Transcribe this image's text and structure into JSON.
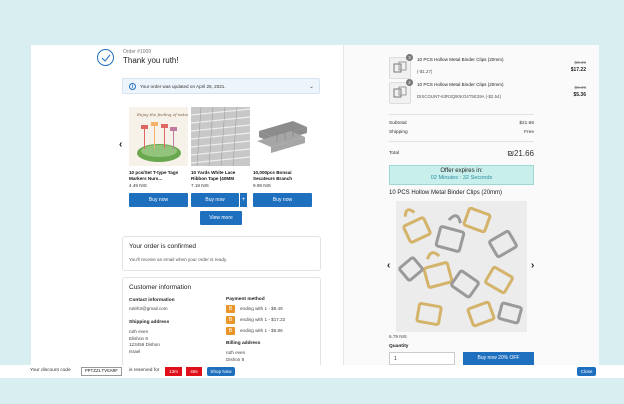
{
  "header": {
    "order_number": "Order #1009",
    "thank_you": "Thank you ruth!"
  },
  "update_notice": {
    "text": "Your order was updated on April 25, 2021.",
    "info_glyph": "i",
    "chevron": "⌄"
  },
  "recommendations": {
    "products": [
      {
        "name": "10 pcs/Set T-type Tags Markers Nurs...",
        "price": "4.49 NIS",
        "buy_label": "Buy now"
      },
      {
        "name": "10 Yards White Lace Ribbon Tape (40MM",
        "price": "7.18 NIS",
        "buy_label": "Buy now",
        "plus_label": "+"
      },
      {
        "name": "10,000pcs Bonsai Secateurs Branch",
        "price": "9.99 NIS",
        "buy_label": "Buy now"
      }
    ],
    "view_more": "View more",
    "prev_arrow": "‹",
    "next_arrow": "›"
  },
  "confirmed": {
    "title": "Your order is confirmed",
    "text": "You'll receive an email when your order is ready."
  },
  "customer_info": {
    "title": "Customer information",
    "contact_label": "Contact information",
    "email": "ruteh2@gmail.com",
    "shipping_label": "Shipping address",
    "shipping_lines": [
      "ruth even",
      "Elishon 8",
      "123456 Dishon",
      "Israel"
    ],
    "payment_label": "Payment method",
    "payments": [
      {
        "icon": "B",
        "text": "ending with 1 - $8.49"
      },
      {
        "icon": "B",
        "text": "ending with 1 - $17.22"
      },
      {
        "icon": "B",
        "text": "ending with 1 - $5.86"
      }
    ],
    "billing_label": "Billing address",
    "billing_lines": [
      "ruth even",
      "Dishon 8"
    ]
  },
  "cart": {
    "items": [
      {
        "qty": "3",
        "name": "10 PCS Hollow Metal Binder Clips (20mm)",
        "discount": "(-$1.27)",
        "original": "$8.49",
        "price": "$17.22"
      },
      {
        "qty": "2",
        "name": "10 PCS Hollow Metal Binder Clips (20mm)",
        "discount": "DISCOUNT-63R3Q90KO4T5E29A (-$2.54)",
        "original": "$8.49",
        "price": "$5.36"
      }
    ],
    "subtotal_label": "Subtotal",
    "subtotal_value": "$21.66",
    "shipping_label": "Shipping",
    "shipping_value": "Free",
    "total_label": "Total",
    "total_value": "₪21.66"
  },
  "offer": {
    "title": "Offer expires in:",
    "countdown": "02 Minutes : 32 Seconds",
    "product_title": "10 PCS Hollow Metal Binder Clips (20mm)",
    "price": "6.79 NIS",
    "quantity_label": "Quantity",
    "quantity_value": "1",
    "buy_label": "Buy now 20% OFF"
  },
  "bottom_bar": {
    "code_label": "Your discount code",
    "code": "PPTZZLTVGARF",
    "reserved_label": "is reserved for",
    "minutes": "13m",
    "seconds": "46s",
    "shop_now": "Shop Now",
    "close": "Close"
  },
  "colors": {
    "accent": "#1f6fbf",
    "offer_bg": "#c8efeb",
    "timer_red": "#e0101a",
    "page_bg": "#d8eef0"
  }
}
